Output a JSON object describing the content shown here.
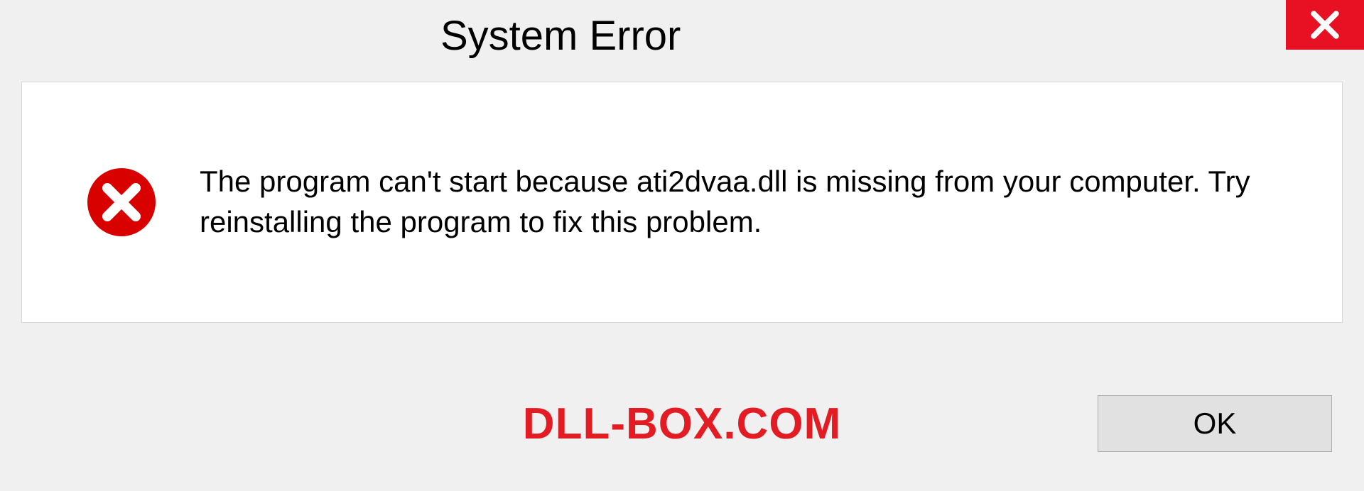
{
  "dialog": {
    "title": "System Error",
    "message": "The program can't start because ati2dvaa.dll is missing from your computer. Try reinstalling the program to fix this problem.",
    "ok_label": "OK"
  },
  "watermark": "DLL-BOX.COM",
  "colors": {
    "close_bg": "#e81123",
    "error_icon": "#d90000",
    "watermark": "#e31b23"
  }
}
